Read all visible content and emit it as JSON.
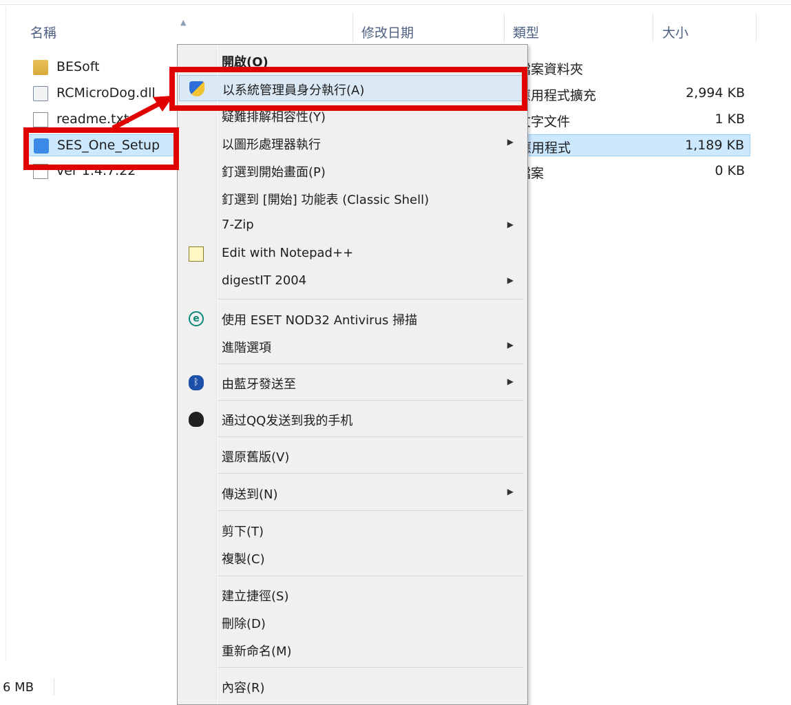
{
  "columns": {
    "name": "名稱",
    "date": "修改日期",
    "type": "類型",
    "size": "大小"
  },
  "sort_icon": "sort-ascending-icon",
  "files": [
    {
      "name": "BESoft",
      "type": "檔案資料夾",
      "size": "",
      "icon": "folder-icon",
      "selected": false
    },
    {
      "name": "RCMicroDog.dll",
      "type": "應用程式擴充",
      "size": "2,994 KB",
      "icon": "dll-icon",
      "selected": false
    },
    {
      "name": "readme.txt",
      "type": "文字文件",
      "size": "1 KB",
      "icon": "text-file-icon",
      "selected": false
    },
    {
      "name": "SES_One_Setup",
      "type": "應用程式",
      "size": "1,189 KB",
      "icon": "installer-icon",
      "selected": true
    },
    {
      "name": "ver 1.4.7.22",
      "type": "檔案",
      "size": "0 KB",
      "icon": "file-icon",
      "selected": false
    }
  ],
  "status_bar": {
    "text": "6 MB"
  },
  "context_menu": {
    "items": [
      {
        "label": "開啟(O)",
        "bold": true
      },
      {
        "label": "以系統管理員身分執行(A)",
        "icon": "uac-shield-icon",
        "highlighted": true
      },
      {
        "label": "疑難排解相容性(Y)"
      },
      {
        "label": "以圖形處理器執行",
        "submenu": true
      },
      {
        "label": "釘選到開始畫面(P)"
      },
      {
        "label": "釘選到 [開始] 功能表 (Classic Shell)"
      },
      {
        "label": "7-Zip",
        "submenu": true
      },
      {
        "label": "Edit with Notepad++",
        "icon": "notepad-plus-plus-icon"
      },
      {
        "label": "digestIT 2004",
        "submenu": true
      },
      {
        "label": "使用 ESET NOD32 Antivirus 掃描",
        "icon": "eset-icon",
        "icon_text": "e"
      },
      {
        "label": "進階選項",
        "submenu": true
      },
      {
        "label": "由藍牙發送至",
        "icon": "bluetooth-icon",
        "submenu": true
      },
      {
        "label": "通过QQ发送到我的手机",
        "icon": "qq-penguin-icon"
      },
      {
        "label": "還原舊版(V)"
      },
      {
        "label": "傳送到(N)",
        "submenu": true
      },
      {
        "label": "剪下(T)"
      },
      {
        "label": "複製(C)"
      },
      {
        "label": "建立捷徑(S)"
      },
      {
        "label": "刪除(D)"
      },
      {
        "label": "重新命名(M)"
      },
      {
        "label": "內容(R)"
      }
    ]
  },
  "annotation": {
    "color": "#e00000",
    "highlight_color": "#dbe9f5",
    "selection_color": "#cce8ff"
  }
}
